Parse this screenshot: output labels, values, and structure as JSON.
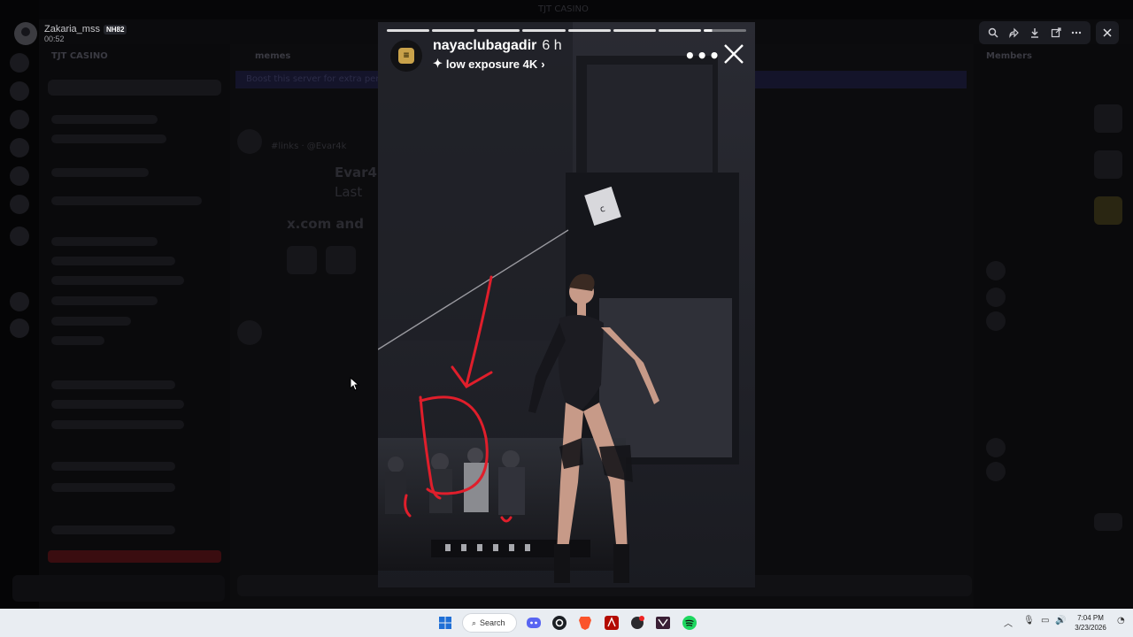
{
  "window": {
    "title": "TJT CASINO"
  },
  "background_app": {
    "server_name": "TJT CASINO",
    "banner_text": "Boost this server for extra perks",
    "heading": "Evar4",
    "subheading": "Last",
    "link_text": "x.com and",
    "mention": "#links · @Evar4k",
    "member_section": "Members"
  },
  "viewer": {
    "uploader_name": "Zakaria_mss",
    "uploader_badge": "NH82",
    "uploader_time": "00:52",
    "tools": [
      "zoom-icon",
      "forward-icon",
      "download-icon",
      "open-external-icon",
      "more-icon"
    ]
  },
  "story": {
    "username": "nayaclubagadir",
    "age": "6 h",
    "audio_label": "low exposure 4K",
    "segments_total": 8,
    "segments_done": 7,
    "annotation_letter": "D",
    "scene_label": "c",
    "colors": {
      "annotation": "#e01e2b",
      "avatar_logo": "#c9a24a"
    }
  },
  "taskbar": {
    "search_label": "Search",
    "time": "7:04 PM",
    "date": "3/23/2026",
    "apps": [
      "windows-start-icon",
      "search-icon",
      "discord-icon",
      "github-icon",
      "brave-icon",
      "acrobat-icon",
      "app-icon",
      "app-icon-2",
      "spotify-icon"
    ]
  }
}
